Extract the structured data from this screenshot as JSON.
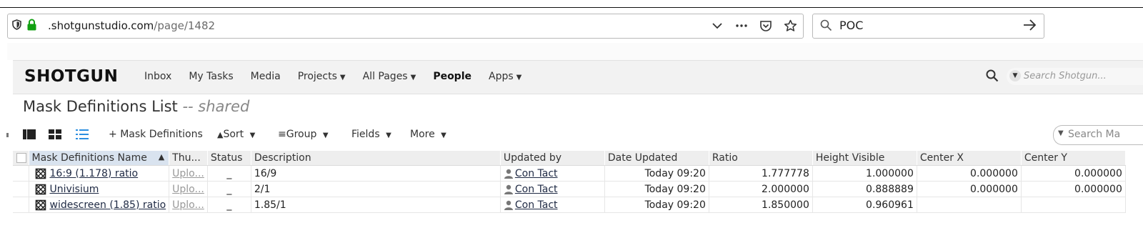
{
  "browser": {
    "url_host": ".shotgunstudio.com",
    "url_path": "/page/1482",
    "search_value": "POC"
  },
  "nav": {
    "logo": "SHOTGUN",
    "items": [
      {
        "label": "Inbox",
        "chevron": false
      },
      {
        "label": "My Tasks",
        "chevron": false
      },
      {
        "label": "Media",
        "chevron": false
      },
      {
        "label": "Projects",
        "chevron": true
      },
      {
        "label": "All Pages",
        "chevron": true
      },
      {
        "label": "People",
        "chevron": false,
        "bold": true
      },
      {
        "label": "Apps",
        "chevron": true
      }
    ],
    "search_placeholder": "Search Shotgun..."
  },
  "page": {
    "title": "Mask Definitions List",
    "subtitle": "-- shared"
  },
  "toolbar": {
    "add_label": "Mask Definitions",
    "sort_label": "Sort",
    "group_label": "Group",
    "fields_label": "Fields",
    "more_label": "More",
    "search_placeholder": "Search Ma"
  },
  "table": {
    "columns": [
      "Mask Definitions Name",
      "Thu...",
      "Status",
      "Description",
      "Updated by",
      "Date Updated",
      "Ratio",
      "Height Visible",
      "Center X",
      "Center Y"
    ],
    "rows": [
      {
        "name": "16:9 (1.178) ratio",
        "thumb": "Uplo...",
        "status": "_",
        "description": "16/9",
        "updated_by": "Con Tact",
        "date_updated": "Today 09:20",
        "ratio": "1.777778",
        "height_visible": "1.000000",
        "center_x": "0.000000",
        "center_y": "0.000000"
      },
      {
        "name": "Univisium",
        "thumb": "Uplo...",
        "status": "_",
        "description": "2/1",
        "updated_by": "Con Tact",
        "date_updated": "Today 09:20",
        "ratio": "2.000000",
        "height_visible": "0.888889",
        "center_x": "0.000000",
        "center_y": "0.000000"
      },
      {
        "name": "widescreen (1.85) ratio",
        "thumb": "Uplo...",
        "status": "_",
        "description": "1.85/1",
        "updated_by": "Con Tact",
        "date_updated": "Today 09:20",
        "ratio": "1.850000",
        "height_visible": "0.960961",
        "center_x": "",
        "center_y": ""
      }
    ]
  }
}
